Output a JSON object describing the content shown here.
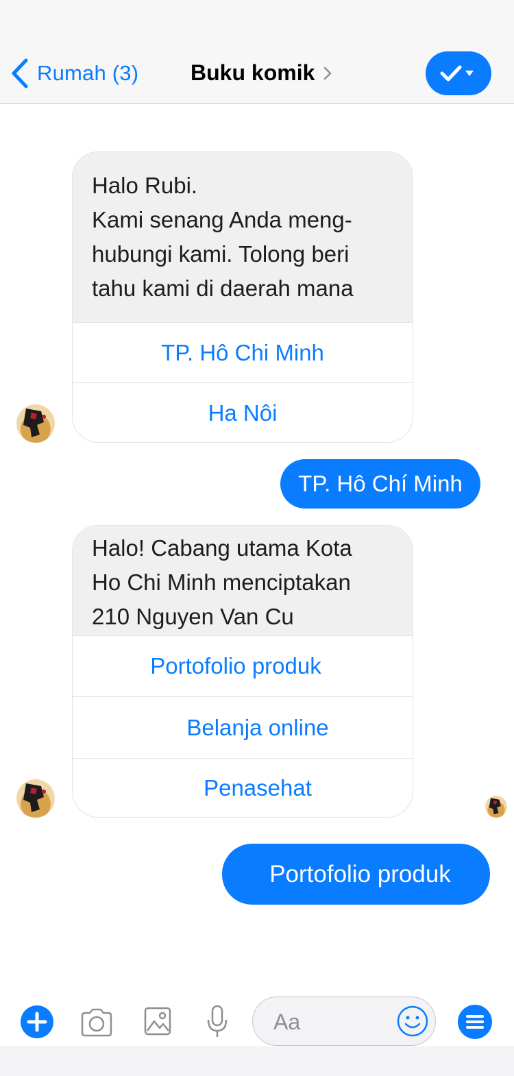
{
  "header": {
    "back_label": "Rumah (3)",
    "title": "Buku komik"
  },
  "messages": [
    {
      "from": "bot",
      "lines": [
        "Halo Rubi.",
        "Kami senang Anda meng-",
        "hubungi kami. Tolong beri",
        "tahu kami di daerah mana"
      ],
      "options": [
        "TP. Hô Chi Minh",
        "Ha Nôi"
      ]
    },
    {
      "from": "user",
      "text": "TP. Hô Chí Minh"
    },
    {
      "from": "bot",
      "lines": [
        "Halo! Cabang utama Kota",
        "Ho Chi Minh menciptakan",
        "210 Nguyen Van Cu"
      ],
      "options": [
        "Portofolio produk",
        "Belanja online",
        "Penasehat"
      ]
    },
    {
      "from": "user",
      "text": "Portofolio produk"
    }
  ],
  "composer": {
    "placeholder": "Aa"
  },
  "colors": {
    "accent": "#0a7cff",
    "bubble_in": "#f0f0f0"
  },
  "icons": [
    "chevron-left-icon",
    "chevron-right-icon",
    "checkmark-icon",
    "caret-down-icon",
    "plus-icon",
    "camera-icon",
    "image-icon",
    "microphone-icon",
    "smiley-icon",
    "menu-icon"
  ]
}
